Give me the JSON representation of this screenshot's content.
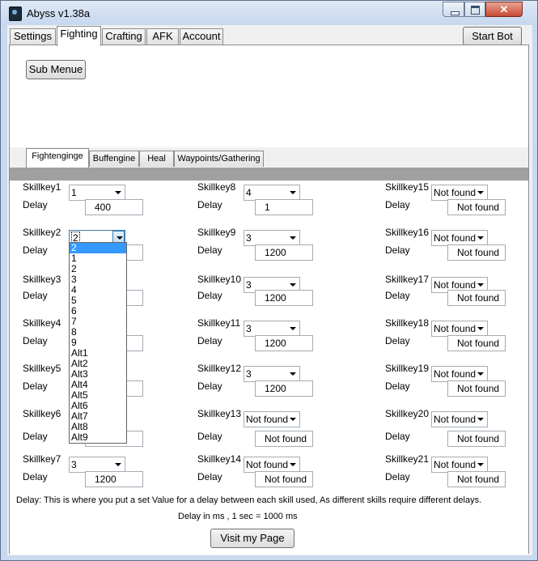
{
  "window": {
    "title": "Abyss v1.38a",
    "close_glyph": "✕"
  },
  "tabs": [
    {
      "label": "Settings"
    },
    {
      "label": "Fighting"
    },
    {
      "label": "Crafting"
    },
    {
      "label": "AFK"
    },
    {
      "label": "Account"
    }
  ],
  "start_bot_label": "Start Bot",
  "sub_menue_label": "Sub Menue",
  "subtabs": [
    {
      "label": "Fightenginge"
    },
    {
      "label": "Buffengine"
    },
    {
      "label": "Heal"
    },
    {
      "label": "Waypoints/Gathering"
    }
  ],
  "delay_label": "Delay",
  "skillkeys": [
    {
      "label": "Skillkey1",
      "key": "1",
      "delay": "400"
    },
    {
      "label": "Skillkey2",
      "key": "2",
      "delay": ""
    },
    {
      "label": "Skillkey3",
      "key": "",
      "delay": ""
    },
    {
      "label": "Skillkey4",
      "key": "",
      "delay": ""
    },
    {
      "label": "Skillkey5",
      "key": "",
      "delay": ""
    },
    {
      "label": "Skillkey6",
      "key": "",
      "delay": ""
    },
    {
      "label": "Skillkey7",
      "key": "3",
      "delay": "1200"
    },
    {
      "label": "Skillkey8",
      "key": "4",
      "delay": "1"
    },
    {
      "label": "Skillkey9",
      "key": "3",
      "delay": "1200"
    },
    {
      "label": "Skillkey10",
      "key": "3",
      "delay": "1200"
    },
    {
      "label": "Skillkey11",
      "key": "3",
      "delay": "1200"
    },
    {
      "label": "Skillkey12",
      "key": "3",
      "delay": "1200"
    },
    {
      "label": "Skillkey13",
      "key": "Not found",
      "delay": "Not found"
    },
    {
      "label": "Skillkey14",
      "key": "Not found",
      "delay": "Not found"
    },
    {
      "label": "Skillkey15",
      "key": "Not found",
      "delay": "Not found"
    },
    {
      "label": "Skillkey16",
      "key": "Not found",
      "delay": "Not found"
    },
    {
      "label": "Skillkey17",
      "key": "Not found",
      "delay": "Not found"
    },
    {
      "label": "Skillkey18",
      "key": "Not found",
      "delay": "Not found"
    },
    {
      "label": "Skillkey19",
      "key": "Not found",
      "delay": "Not found"
    },
    {
      "label": "Skillkey20",
      "key": "Not found",
      "delay": "Not found"
    },
    {
      "label": "Skillkey21",
      "key": "Not found",
      "delay": "Not found"
    }
  ],
  "dropdown_options": [
    "2",
    "1",
    "2",
    "3",
    "4",
    "5",
    "6",
    "7",
    "8",
    "9",
    "Alt1",
    "Alt2",
    "Alt3",
    "Alt4",
    "Alt5",
    "Alt6",
    "Alt7",
    "Alt8",
    "Alt9"
  ],
  "info_text": "Delay: This is where you put a set Value for a delay between each skill used, As different skills require different delays.",
  "info_units": "Delay in ms , 1 sec = 1000 ms",
  "visit_label": "Visit my Page"
}
